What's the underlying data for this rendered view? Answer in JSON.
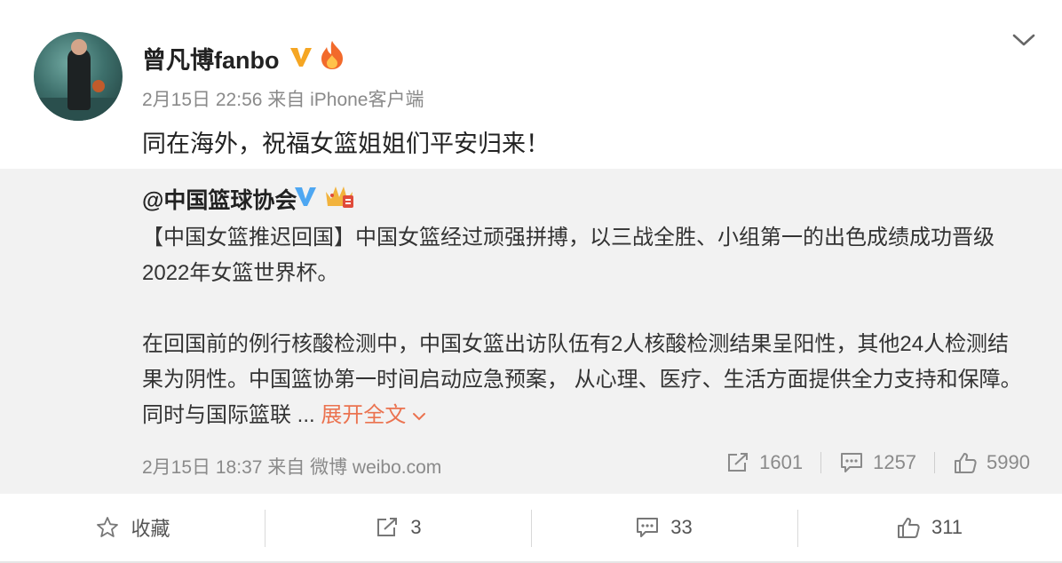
{
  "post": {
    "user_name": "曾凡博fanbo",
    "meta": "2月15日 22:56 来自 iPhone客户端",
    "text": "同在海外，祝福女篮姐姐们平安归来！"
  },
  "repost": {
    "user": "@中国篮球协会",
    "para1_line1": "【中国女篮推迟回国】中国女篮经过顽强拼搏，以三战全胜、小组第一的出色成绩成功晋级",
    "para1_line2": "2022年女篮世界杯。",
    "para2_line1": "在回国前的例行核酸检测中，中国女篮出访队伍有2人核酸检测结果呈阳性，其他24人检测结",
    "para2_line2": "果为阴性。中国篮协第一时间启动应急预案， 从心理、医疗、生活方面提供全力支持和保障。",
    "para2_line3": "同时与国际篮联 ...",
    "expand_label": "展开全文",
    "meta": "2月15日 18:37 来自 微博 weibo.com",
    "forward_count": "1601",
    "comment_count": "1257",
    "like_count": "5990"
  },
  "actions": {
    "favorite_label": "收藏",
    "forward_count": "3",
    "comment_count": "33",
    "like_count": "311"
  },
  "colors": {
    "link": "#eb7350",
    "verify_gold": "#f5a623",
    "verify_blue": "#4ea7f2",
    "muted": "#8a8a8a"
  }
}
